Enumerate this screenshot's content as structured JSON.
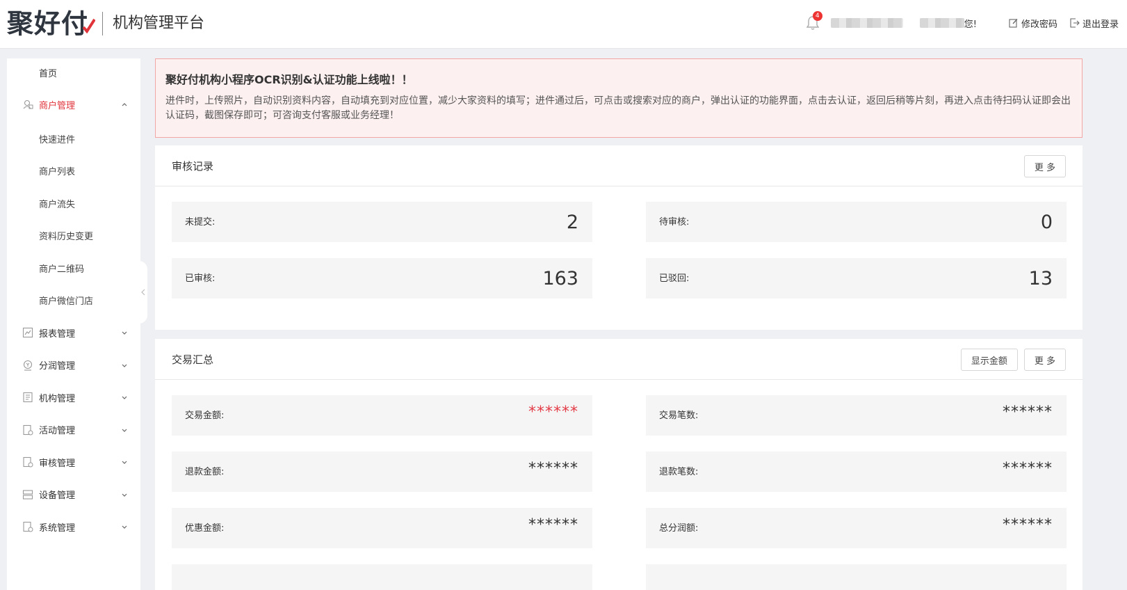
{
  "header": {
    "logo_text": "聚好付",
    "platform_name": "机构管理平台",
    "notification_count": "4",
    "greeting_suffix": "您!",
    "change_password": "修改密码",
    "logout": "退出登录"
  },
  "sidebar": {
    "home": "首页",
    "merchant_management": "商户管理",
    "merchant_sub": [
      "快速进件",
      "商户列表",
      "商户流失",
      "资料历史变更",
      "商户二维码",
      "商户微信门店"
    ],
    "groups": [
      "报表管理",
      "分润管理",
      "机构管理",
      "活动管理",
      "审核管理",
      "设备管理",
      "系统管理"
    ]
  },
  "notice": {
    "title": "聚好付机构小程序OCR识别&认证功能上线啦！！",
    "body": "进件时，上传照片，自动识别资料内容，自动填充到对应位置，减少大家资料的填写；进件通过后，可点击或搜索对应的商户，弹出认证的功能界面，点击去认证，返回后稍等片刻，再进入点击待扫码认证即会出认证码，截图保存即可；可咨询支付客服或业务经理！"
  },
  "audit": {
    "title": "审核记录",
    "more": "更 多",
    "not_submitted_label": "未提交:",
    "not_submitted_value": "2",
    "pending_label": "待审核:",
    "pending_value": "0",
    "approved_label": "已审核:",
    "approved_value": "163",
    "rejected_label": "已驳回:",
    "rejected_value": "13"
  },
  "transactions": {
    "title": "交易汇总",
    "show_amount": "显示金额",
    "more": "更 多",
    "amount_label": "交易金额:",
    "amount_value": "******",
    "count_label": "交易笔数:",
    "count_value": "******",
    "refund_amount_label": "退款金额:",
    "refund_amount_value": "******",
    "refund_count_label": "退款笔数:",
    "refund_count_value": "******",
    "discount_label": "优惠金额:",
    "discount_value": "******",
    "profit_label": "总分润额:",
    "profit_value": "******"
  },
  "colors": {
    "accent": "#e0333a",
    "notice_bg": "#fdf0f0",
    "notice_border": "#f3a6a6",
    "masked_red": "#e33c47"
  }
}
